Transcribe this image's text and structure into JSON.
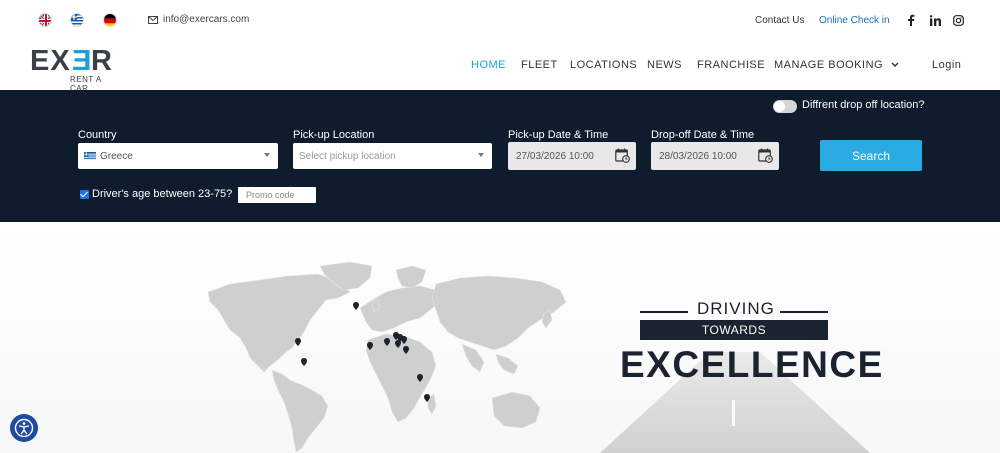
{
  "topbar": {
    "flags": [
      "uk-flag",
      "greece-flag",
      "germany-flag"
    ],
    "email": "info@exercars.com",
    "contact_label": "Contact Us",
    "checkin_label": "Online Check in",
    "social": [
      "facebook-icon",
      "linkedin-icon",
      "instagram-icon"
    ]
  },
  "header": {
    "logo_main": "EX",
    "logo_e3": "E",
    "logo_r": "R",
    "logo_sub": "RENT A CAR",
    "nav": [
      {
        "label": "HOME",
        "active": true
      },
      {
        "label": "FLEET"
      },
      {
        "label": "LOCATIONS"
      },
      {
        "label": "NEWS"
      },
      {
        "label": "FRANCHISE"
      },
      {
        "label": "MANAGE BOOKING"
      }
    ],
    "login_label": "Login"
  },
  "search": {
    "toggle_label": "Diffrent drop off location?",
    "country_label": "Country",
    "country_value": "Greece",
    "pickup_label": "Pick-up Location",
    "pickup_placeholder": "Select pickup location",
    "pickup_date_label": "Pick-up Date & Time",
    "pickup_date_value": "27/03/2026 10:00",
    "dropoff_date_label": "Drop-off Date & Time",
    "dropoff_date_value": "28/03/2026 10:00",
    "search_label": "Search",
    "age_label": "Driver's age between 23-75?",
    "promo_placeholder": "Promo code"
  },
  "hero": {
    "driving": "DRIVING",
    "towards": "TOWARDS",
    "excellence": "EXCELLENCE"
  },
  "colors": {
    "accent": "#29abe2",
    "panel": "#0f1c2e",
    "dark_text": "#1b2330"
  }
}
